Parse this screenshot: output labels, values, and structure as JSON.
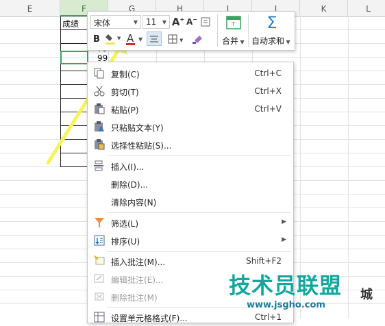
{
  "spreadsheet": {
    "columns": [
      "E",
      "F",
      "G",
      "H",
      "I",
      "J",
      "K",
      "L"
    ],
    "selected_column": "F",
    "cells": {
      "f_header": "成绩",
      "f_value_partial": "79",
      "f_value_selected": "99"
    }
  },
  "mini_toolbar": {
    "font_name": "宋体",
    "font_size": "11",
    "bold_label": "B",
    "font_color_label": "A",
    "merge_label": "合并",
    "autosum_label": "自动求和",
    "colors": {
      "fill_yellow": "#ffe14b",
      "font_red": "#e02424",
      "merge_green": "#3aa35d"
    }
  },
  "context_menu": {
    "items": [
      {
        "label": "复制(C)",
        "shortcut": "Ctrl+C",
        "icon": "copy-icon",
        "enabled": true
      },
      {
        "label": "剪切(T)",
        "shortcut": "Ctrl+X",
        "icon": "scissors-icon",
        "enabled": true
      },
      {
        "label": "粘贴(P)",
        "shortcut": "Ctrl+V",
        "icon": "paste-icon",
        "enabled": true
      },
      {
        "label": "只粘贴文本(Y)",
        "shortcut": "",
        "icon": "paste-text-icon",
        "enabled": true
      },
      {
        "label": "选择性粘贴(S)...",
        "shortcut": "",
        "icon": "paste-special-icon",
        "enabled": true
      },
      {
        "label": "插入(I)...",
        "shortcut": "",
        "icon": "insert-icon",
        "enabled": true
      },
      {
        "label": "删除(D)...",
        "shortcut": "",
        "icon": "",
        "enabled": true
      },
      {
        "label": "清除内容(N)",
        "shortcut": "",
        "icon": "",
        "enabled": true
      },
      {
        "label": "筛选(L)",
        "shortcut": "",
        "icon": "filter-icon",
        "enabled": true,
        "submenu": true
      },
      {
        "label": "排序(U)",
        "shortcut": "",
        "icon": "sort-icon",
        "enabled": true,
        "submenu": true
      },
      {
        "label": "插入批注(M)...",
        "shortcut": "Shift+F2",
        "icon": "insert-comment-icon",
        "enabled": true
      },
      {
        "label": "编辑批注(E)...",
        "shortcut": "",
        "icon": "edit-comment-icon",
        "enabled": false
      },
      {
        "label": "删除批注(M)",
        "shortcut": "",
        "icon": "delete-comment-icon",
        "enabled": false
      },
      {
        "label": "设置单元格格式(F)...",
        "shortcut": "Ctrl+1",
        "icon": "format-cells-icon",
        "enabled": true
      }
    ]
  },
  "annotation": {
    "arrow_color": "#f5f55a",
    "arrow_icon": "arrow-pointer-icon"
  },
  "watermark": {
    "main_text": "技术员联盟",
    "url_text": "www.jsgho.com",
    "city_text": "城"
  }
}
